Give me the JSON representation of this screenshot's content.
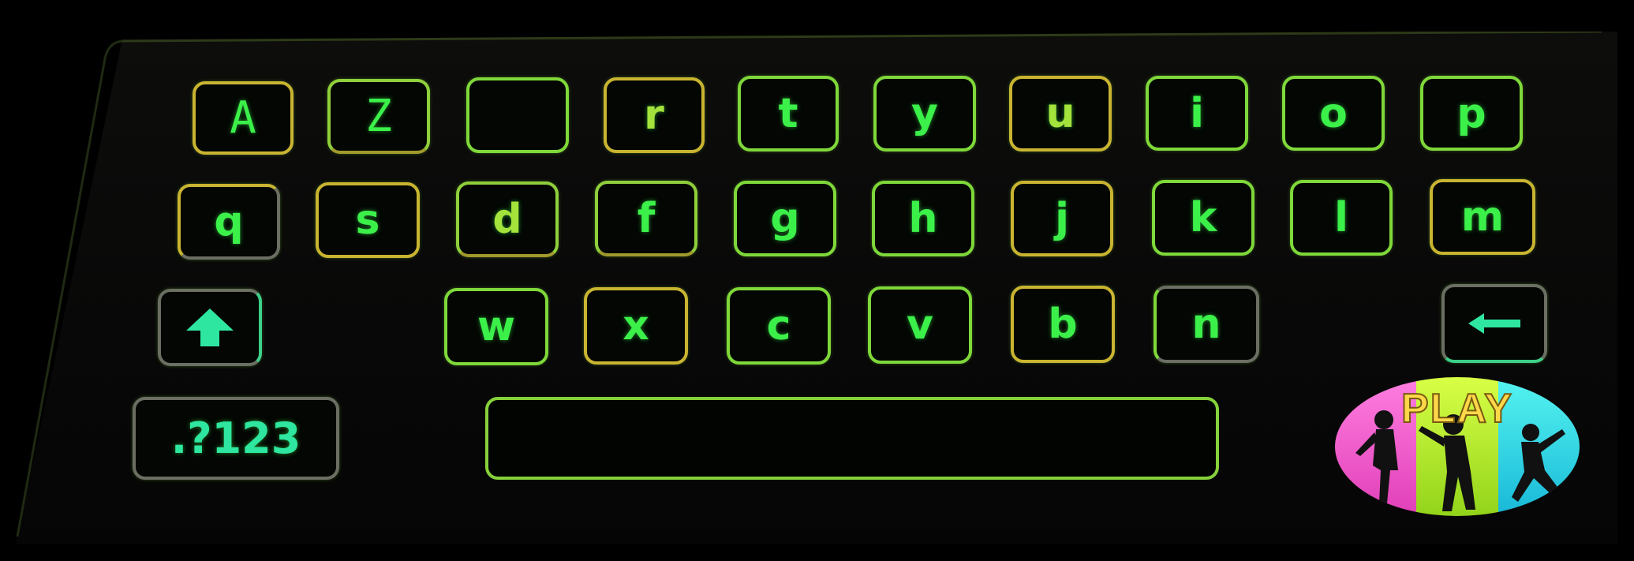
{
  "keyboard": {
    "row1": [
      "A",
      "Z",
      "",
      "r",
      "t",
      "y",
      "u",
      "i",
      "o",
      "p"
    ],
    "row2": [
      "q",
      "s",
      "d",
      "f",
      "g",
      "h",
      "j",
      "k",
      "l",
      "m"
    ],
    "row3": [
      "w",
      "x",
      "c",
      "v",
      "b",
      "n"
    ],
    "symbols_label": ".?123",
    "shift_icon": "up-arrow-icon",
    "backspace_icon": "left-arrow-icon"
  },
  "play_badge": {
    "label": "PLAY",
    "colors": [
      "#ff5fd0",
      "#b8ff2a",
      "#2ee6e0"
    ]
  },
  "colors": {
    "key_text": "#3cf04a",
    "key_border_green": "#7fd83a",
    "key_border_amber": "#c9b431",
    "background": "#000000"
  }
}
